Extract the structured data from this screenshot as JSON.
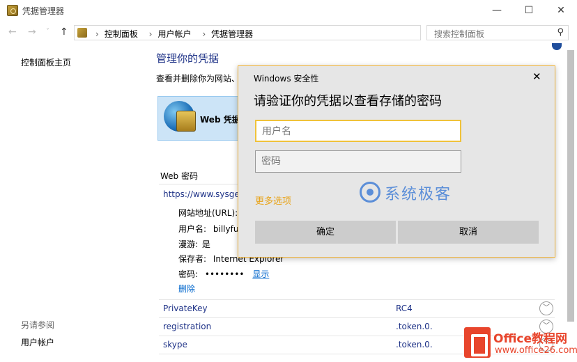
{
  "window": {
    "title": "凭据管理器",
    "buttons": {
      "minimize": "—",
      "maximize": "☐",
      "close": "✕"
    }
  },
  "nav": {
    "back": "←",
    "forward": "→",
    "recent": "˅",
    "up": "↑",
    "breadcrumb": [
      "控制面板",
      "用户帐户",
      "凭据管理器"
    ],
    "separator": "›",
    "search_placeholder": "搜索控制面板"
  },
  "sidebar": {
    "home_link": "控制面板主页",
    "see_also_heading": "另请参阅",
    "see_also_links": [
      "用户帐户"
    ]
  },
  "main": {
    "title": "管理你的凭据",
    "description": "查看并删除你为网站、",
    "web_cred_tile": "Web 凭据",
    "section_label": "Web 密码",
    "entry": {
      "url": "https://www.sysgee",
      "details": [
        {
          "label": "网站地址(URL):",
          "value": ""
        },
        {
          "label": "用户名:",
          "value": "billyfu"
        },
        {
          "label": "漫游:",
          "value": "是"
        },
        {
          "label": "保存者:",
          "value": "Internet Explorer"
        },
        {
          "label": "密码:",
          "value": "••••••••"
        }
      ],
      "show_link": "显示",
      "delete_link": "删除"
    },
    "credentials": [
      {
        "name": "PrivateKey",
        "type": "RC4"
      },
      {
        "name": "registration",
        "type": ".token.0."
      },
      {
        "name": "skype",
        "type": ".token.0."
      }
    ]
  },
  "dialog": {
    "title": "Windows 安全性",
    "close": "✕",
    "heading": "请验证你的凭据以查看存储的密码",
    "username_placeholder": "用户名",
    "password_placeholder": "密码",
    "more_options": "更多选项",
    "watermark": "系统极客",
    "ok_button": "确定",
    "cancel_button": "取消"
  },
  "badge": {
    "name": "Office教程网",
    "url": "www.office26.com"
  },
  "colors": {
    "accent_title": "#1e3287",
    "link": "#0066cc",
    "dialog_border": "#f0b43a",
    "more_options": "#e8a317",
    "badge": "#e8452c"
  }
}
